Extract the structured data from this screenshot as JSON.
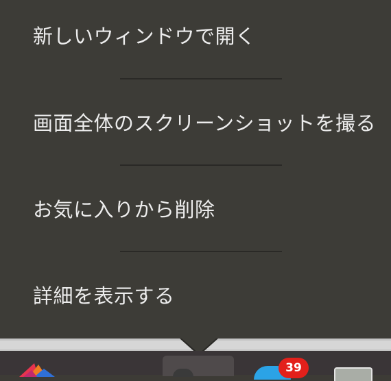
{
  "menu": {
    "items": [
      {
        "label": "新しいウィンドウで開く"
      },
      {
        "label": "画面全体のスクリーンショットを撮る"
      },
      {
        "label": "お気に入りから削除"
      },
      {
        "label": "詳細を表示する"
      }
    ]
  },
  "dock": {
    "notification_badge": "39"
  },
  "colors": {
    "menu_background": "#3d3c37",
    "menu_text": "#ececec",
    "badge": "#e3201b",
    "accent_blue": "#2ba3e6"
  }
}
